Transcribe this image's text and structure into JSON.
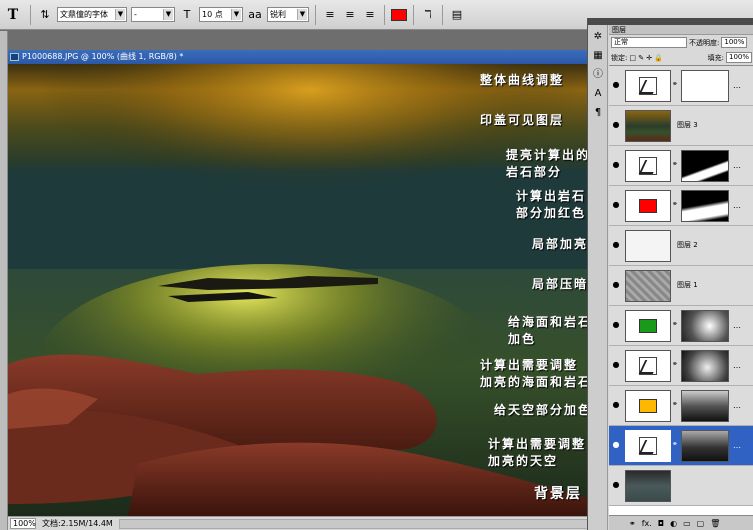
{
  "optbar": {
    "tool": "T",
    "font_family": "文鼎僮的字体",
    "font_style": "-",
    "size_icon": "T",
    "font_size": "10 点",
    "aa_icon": "aa",
    "antialias": "锐利",
    "text_color": "#ff0000"
  },
  "document": {
    "title": "P1000688.JPG @ 100% (曲线 1, RGB/8) *",
    "zoom": "100%",
    "doc_info": "文档:2.15M/14.4M"
  },
  "annotations": [
    "整体曲线调整",
    "印盖可见图层",
    "提亮计算出的",
    "岩石部分",
    "计算出岩石",
    "部分加红色",
    "局部加亮",
    "局部压暗",
    "给海面和岩石",
    "加色",
    "计算出需要调整",
    "加亮的海面和岩石",
    "给天空部分加色",
    "计算出需要调整",
    "加亮的天空",
    "背景层"
  ],
  "layers_panel": {
    "tab": "图层",
    "blend_mode": "正常",
    "opacity_label": "不透明度:",
    "opacity": "100%",
    "lock_label": "锁定:",
    "fill_label": "填充:",
    "fill": "100%",
    "layers": [
      {
        "type": "curves",
        "name": "",
        "mask": "white"
      },
      {
        "type": "image",
        "name": "图层 3"
      },
      {
        "type": "curves",
        "name": "",
        "mask": "rocks"
      },
      {
        "type": "fill",
        "color": "#ff0000",
        "name": "",
        "mask": "rocks"
      },
      {
        "type": "white",
        "name": "图层 2"
      },
      {
        "type": "gray",
        "name": "图层 1"
      },
      {
        "type": "fill",
        "color": "#1a9a1a",
        "name": "",
        "mask": "sea"
      },
      {
        "type": "curves",
        "name": "",
        "mask": "sea2"
      },
      {
        "type": "fill",
        "color": "#ffb800",
        "name": "",
        "mask": "sky"
      },
      {
        "type": "curves",
        "name": "",
        "mask": "sky2",
        "active": true
      },
      {
        "type": "image",
        "name": ""
      }
    ],
    "bottom_icons": [
      "link",
      "fx",
      "mask",
      "adjust",
      "group",
      "new",
      "trash"
    ]
  }
}
